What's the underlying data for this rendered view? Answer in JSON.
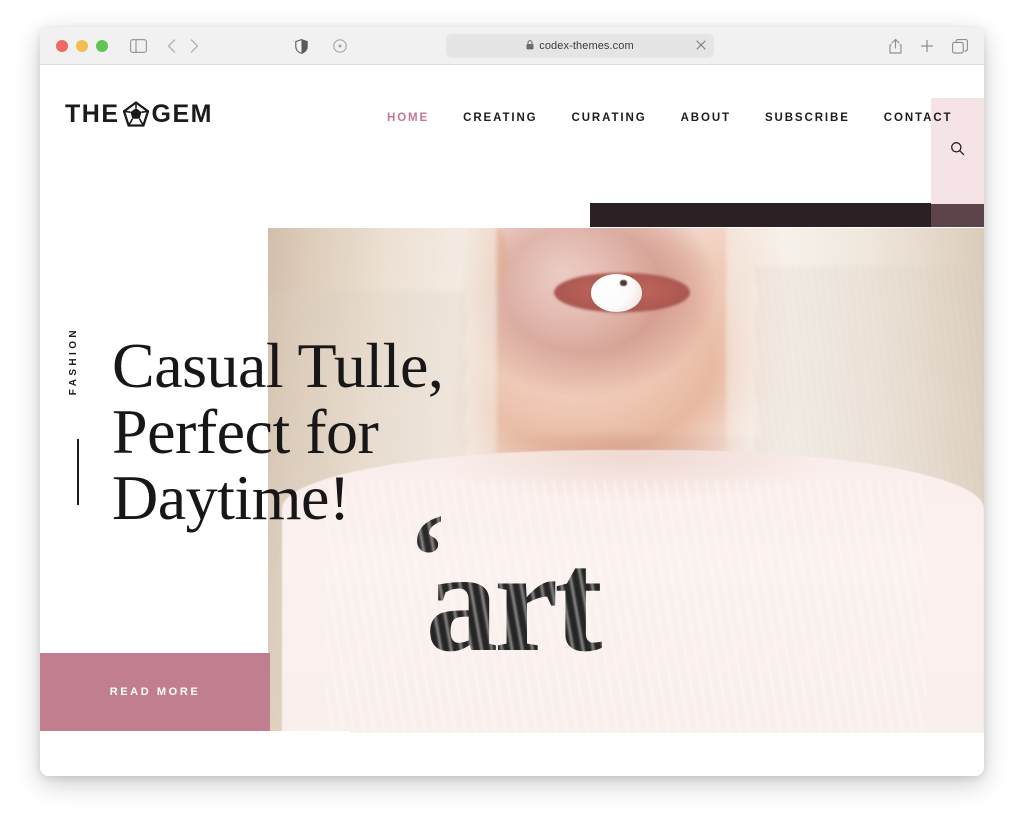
{
  "browser": {
    "traffic_lights": [
      "close",
      "minimize",
      "maximize"
    ],
    "url": "codex-themes.com",
    "lock_icon": "lock-icon",
    "sidebar_icon": "sidebar-toggle-icon",
    "back_icon": "back-arrow-icon",
    "forward_icon": "forward-arrow-icon",
    "shield_icon": "privacy-shield-icon",
    "reload_icon": "reload-icon",
    "close_tab_icon": "close-icon",
    "share_icon": "share-icon",
    "new_tab_icon": "plus-icon",
    "tabs_icon": "tab-overview-icon"
  },
  "site": {
    "logo": {
      "word_left": "THE",
      "word_right": "GEM",
      "mark": "gem-pentagon-icon"
    },
    "nav": [
      {
        "label": "HOME",
        "active": true
      },
      {
        "label": "CREATING",
        "active": false
      },
      {
        "label": "CURATING",
        "active": false
      },
      {
        "label": "ABOUT",
        "active": false
      },
      {
        "label": "SUBSCRIBE",
        "active": false
      },
      {
        "label": "CONTACT",
        "active": false
      }
    ],
    "search": {
      "icon": "search-icon",
      "label": "Search"
    }
  },
  "hero": {
    "category": "FASHION",
    "headline_line1": "Casual Tulle,",
    "headline_line2": "Perfect for",
    "headline_line3": "Daytime!",
    "cta_label": "READ MORE",
    "photo_alt": "Woman with platinum blonde hair blowing a white bubble gum bubble, wearing a pale pink t-shirt",
    "shirt_graphic_text": "art",
    "shirt_graphic_quote": "‘"
  },
  "colors": {
    "accent_pink": "#c4788c",
    "button_rose": "#c07e8f",
    "search_panel": "#f6e3e6",
    "dark_bar": "#2c2024",
    "dark_bar_overlap": "#5d434a",
    "text_dark": "#1b1b1b",
    "chrome_bg": "#f1f1f1"
  }
}
